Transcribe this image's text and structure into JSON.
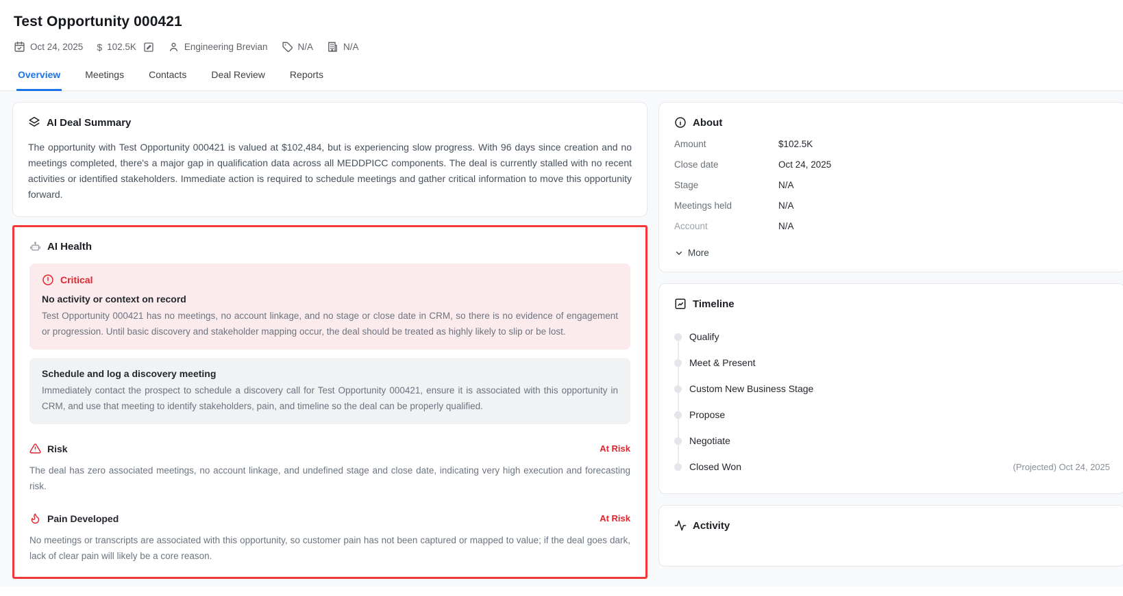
{
  "header": {
    "title": "Test Opportunity 000421",
    "meta": {
      "close_date": "Oct 24, 2025",
      "currency_symbol": "$",
      "amount": "102.5K",
      "owner": "Engineering Brevian",
      "tag": "N/A",
      "account": "N/A"
    }
  },
  "tabs": [
    {
      "label": "Overview",
      "active": true
    },
    {
      "label": "Meetings",
      "active": false
    },
    {
      "label": "Contacts",
      "active": false
    },
    {
      "label": "Deal Review",
      "active": false
    },
    {
      "label": "Reports",
      "active": false
    }
  ],
  "deal_summary": {
    "title": "AI Deal Summary",
    "body": "The opportunity with Test Opportunity 000421 is valued at $102,484, but is experiencing slow progress. With 96 days since creation and no meetings completed, there's a major gap in qualification data across all MEDDPICC components. The deal is currently stalled with no recent activities or identified stakeholders. Immediate action is required to schedule meetings and gather critical information to move this opportunity forward."
  },
  "ai_health": {
    "title": "AI Health",
    "critical": {
      "label": "Critical",
      "heading": "No activity or context on record",
      "body": "Test Opportunity 000421 has no meetings, no account linkage, and no stage or close date in CRM, so there is no evidence of engagement or progression. Until basic discovery and stakeholder mapping occur, the deal should be treated as highly likely to slip or be lost."
    },
    "recommendation": {
      "heading": "Schedule and log a discovery meeting",
      "body": "Immediately contact the prospect to schedule a discovery call for Test Opportunity 000421, ensure it is associated with this opportunity in CRM, and use that meeting to identify stakeholders, pain, and timeline so the deal can be properly qualified."
    },
    "sections": [
      {
        "title": "Risk",
        "status": "At Risk",
        "body": "The deal has zero associated meetings, no account linkage, and undefined stage and close date, indicating very high execution and forecasting risk."
      },
      {
        "title": "Pain Developed",
        "status": "At Risk",
        "body": "No meetings or transcripts are associated with this opportunity, so customer pain has not been captured or mapped to value; if the deal goes dark, lack of clear pain will likely be a core reason."
      }
    ]
  },
  "about": {
    "title": "About",
    "rows": [
      {
        "label": "Amount",
        "value": "$102.5K"
      },
      {
        "label": "Close date",
        "value": "Oct 24, 2025"
      },
      {
        "label": "Stage",
        "value": "N/A"
      },
      {
        "label": "Meetings held",
        "value": "N/A"
      },
      {
        "label": "Account",
        "value": "N/A"
      }
    ],
    "more_label": "More"
  },
  "timeline": {
    "title": "Timeline",
    "stages": [
      {
        "label": "Qualify",
        "note": ""
      },
      {
        "label": "Meet & Present",
        "note": ""
      },
      {
        "label": "Custom New Business Stage",
        "note": ""
      },
      {
        "label": "Propose",
        "note": ""
      },
      {
        "label": "Negotiate",
        "note": ""
      },
      {
        "label": "Closed Won",
        "note": "(Projected) Oct 24, 2025"
      }
    ]
  },
  "activity": {
    "title": "Activity"
  },
  "colors": {
    "accent_blue": "#1a73e8",
    "alert_red": "#e3242e",
    "selection_border_red": "#f23838",
    "critical_bg": "#fcebec",
    "recommendation_bg": "#f0f2f4",
    "card_border": "#e6e8ec",
    "muted_text": "#6b7480"
  }
}
